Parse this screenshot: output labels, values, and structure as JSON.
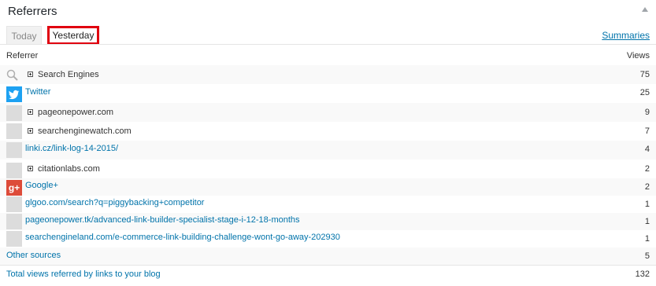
{
  "widget": {
    "title": "Referrers"
  },
  "tabs": {
    "today": "Today",
    "yesterday": "Yesterday"
  },
  "summaries_link": "Summaries",
  "columns": {
    "referrer": "Referrer",
    "views": "Views"
  },
  "rows": [
    {
      "label": "Search Engines",
      "count": "75",
      "icon": "search-icon",
      "expandable": true,
      "link": false
    },
    {
      "label": "Twitter",
      "count": "25",
      "icon": "twitter-icon",
      "expandable": false,
      "link": true
    },
    {
      "label": "pageonepower.com",
      "count": "9",
      "icon": "site-icon",
      "expandable": true,
      "link": false
    },
    {
      "label": "searchenginewatch.com",
      "count": "7",
      "icon": "site-icon",
      "expandable": true,
      "link": false
    },
    {
      "label": "linki.cz/link-log-14-2015/",
      "count": "4",
      "icon": "site-icon",
      "expandable": false,
      "link": true
    },
    {
      "label": "citationlabs.com",
      "count": "2",
      "icon": "site-icon",
      "expandable": true,
      "link": false
    },
    {
      "label": "Google+",
      "count": "2",
      "icon": "google-plus-icon",
      "expandable": false,
      "link": true
    },
    {
      "label": "glgoo.com/search?q=piggybacking+competitor",
      "count": "1",
      "icon": "site-icon",
      "expandable": false,
      "link": true
    },
    {
      "label": "pageonepower.tk/advanced-link-builder-specialist-stage-i-12-18-months",
      "count": "1",
      "icon": "site-icon",
      "expandable": false,
      "link": true
    },
    {
      "label": "searchengineland.com/e-commerce-link-building-challenge-wont-go-away-202930",
      "count": "1",
      "icon": "site-icon",
      "expandable": false,
      "link": true
    }
  ],
  "other_sources": {
    "label": "Other sources",
    "count": "5"
  },
  "total": {
    "label": "Total views referred by links to your blog",
    "count": "132"
  },
  "colors": {
    "link": "#0073aa",
    "highlight_border": "#e0000f",
    "twitter": "#1da1f2",
    "google_plus": "#dd4b39"
  }
}
